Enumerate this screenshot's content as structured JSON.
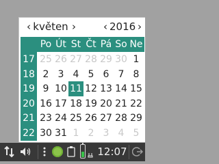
{
  "calendar": {
    "month": "květen",
    "year": "2016",
    "prev_month": "‹",
    "next_month": "›",
    "prev_year": "‹",
    "next_year": "›",
    "weekdays": [
      "Po",
      "Út",
      "St",
      "Čt",
      "Pá",
      "So",
      "Ne"
    ],
    "week_numbers": [
      "17",
      "18",
      "19",
      "20",
      "21",
      "22"
    ],
    "rows": [
      [
        {
          "d": "25",
          "dim": true
        },
        {
          "d": "26",
          "dim": true
        },
        {
          "d": "27",
          "dim": true
        },
        {
          "d": "28",
          "dim": true
        },
        {
          "d": "29",
          "dim": true
        },
        {
          "d": "30",
          "dim": true
        },
        {
          "d": "1",
          "dim": false
        }
      ],
      [
        {
          "d": "2",
          "dim": false
        },
        {
          "d": "3",
          "dim": false
        },
        {
          "d": "4",
          "dim": false
        },
        {
          "d": "5",
          "dim": false
        },
        {
          "d": "6",
          "dim": false
        },
        {
          "d": "7",
          "dim": false
        },
        {
          "d": "8",
          "dim": false
        }
      ],
      [
        {
          "d": "9",
          "dim": false
        },
        {
          "d": "10",
          "dim": false
        },
        {
          "d": "11",
          "dim": false,
          "today": true
        },
        {
          "d": "12",
          "dim": false
        },
        {
          "d": "13",
          "dim": false
        },
        {
          "d": "14",
          "dim": false
        },
        {
          "d": "15",
          "dim": false
        }
      ],
      [
        {
          "d": "16",
          "dim": false
        },
        {
          "d": "17",
          "dim": false
        },
        {
          "d": "18",
          "dim": false
        },
        {
          "d": "19",
          "dim": false
        },
        {
          "d": "20",
          "dim": false
        },
        {
          "d": "21",
          "dim": false
        },
        {
          "d": "22",
          "dim": false
        }
      ],
      [
        {
          "d": "23",
          "dim": false
        },
        {
          "d": "24",
          "dim": false
        },
        {
          "d": "25",
          "dim": false
        },
        {
          "d": "26",
          "dim": false
        },
        {
          "d": "27",
          "dim": false
        },
        {
          "d": "28",
          "dim": false
        },
        {
          "d": "29",
          "dim": false
        }
      ],
      [
        {
          "d": "30",
          "dim": false
        },
        {
          "d": "31",
          "dim": false
        },
        {
          "d": "1",
          "dim": true
        },
        {
          "d": "2",
          "dim": true
        },
        {
          "d": "3",
          "dim": true
        },
        {
          "d": "4",
          "dim": true
        },
        {
          "d": "5",
          "dim": true
        }
      ]
    ],
    "accent_color": "#2b8f7f"
  },
  "taskbar": {
    "clock": "12:07",
    "battery_level": 0.45,
    "icons": [
      "network-icon",
      "volume-icon",
      "settings-icon",
      "clipboard-icon",
      "battery-icon",
      "logout-icon"
    ]
  }
}
